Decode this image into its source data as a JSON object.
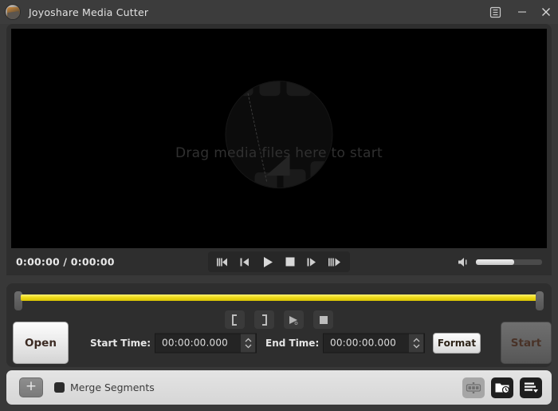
{
  "window": {
    "title": "Joyoshare Media Cutter",
    "app_icon": "film-reel-icon",
    "controls": {
      "menu": "menu-icon",
      "minimize": "minimize-icon",
      "close": "close-icon"
    }
  },
  "player": {
    "drop_hint": "Drag media files here to start",
    "watermark": "film-strip-cut-watermark",
    "time_display": "0:00:00 / 0:00:00",
    "current_time": "0:00:00",
    "total_time": "0:00:00",
    "transport": [
      {
        "name": "previous-segment-button",
        "icon": "skip-back-fast-icon"
      },
      {
        "name": "previous-frame-button",
        "icon": "step-back-icon"
      },
      {
        "name": "play-button",
        "icon": "play-icon"
      },
      {
        "name": "stop-button",
        "icon": "stop-icon"
      },
      {
        "name": "next-frame-button",
        "icon": "step-forward-icon"
      },
      {
        "name": "next-segment-button",
        "icon": "skip-forward-fast-icon"
      }
    ],
    "volume": {
      "icon": "speaker-icon",
      "level_percent": 58
    }
  },
  "editor": {
    "timeline": {
      "left_handle": "trim-start-handle",
      "right_handle": "trim-end-handle",
      "selection_color": "#f2dd20"
    },
    "trim_tools": [
      {
        "name": "set-start-marker-button",
        "icon": "bracket-left-icon"
      },
      {
        "name": "set-end-marker-button",
        "icon": "bracket-right-icon"
      },
      {
        "name": "preview-segment-button",
        "icon": "play-preview-icon"
      },
      {
        "name": "stop-preview-button",
        "icon": "stop-icon"
      }
    ],
    "open_label": "Open",
    "start_time_label": "Start Time:",
    "start_time_value": "00:00:00.000",
    "end_time_label": "End Time:",
    "end_time_value": "00:00:00.000",
    "format_label": "Format",
    "start_label": "Start"
  },
  "bottom": {
    "add_label": "+",
    "merge_label": "Merge Segments",
    "merge_checked": false,
    "icons": [
      {
        "name": "segments-list-icon",
        "state": "disabled"
      },
      {
        "name": "output-folder-icon",
        "state": "active"
      },
      {
        "name": "task-list-icon",
        "state": "active"
      }
    ]
  }
}
